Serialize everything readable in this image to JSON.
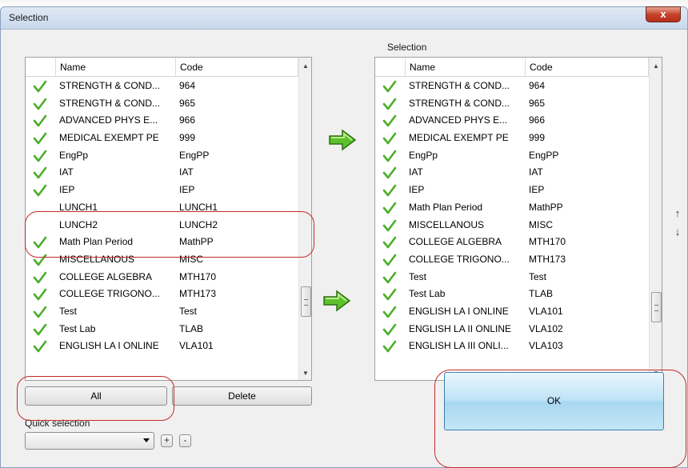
{
  "window": {
    "title": "Selection",
    "close_label": "x"
  },
  "left_list": {
    "columns": {
      "name": "Name",
      "code": "Code"
    },
    "rows": [
      {
        "name": "STRENGTH & COND...",
        "code": "964",
        "checked": true
      },
      {
        "name": "STRENGTH & COND...",
        "code": "965",
        "checked": true
      },
      {
        "name": "ADVANCED PHYS E...",
        "code": "966",
        "checked": true
      },
      {
        "name": "MEDICAL EXEMPT PE",
        "code": "999",
        "checked": true
      },
      {
        "name": "EngPp",
        "code": "EngPP",
        "checked": true
      },
      {
        "name": "IAT",
        "code": "IAT",
        "checked": true
      },
      {
        "name": "IEP",
        "code": "IEP",
        "checked": true
      },
      {
        "name": "LUNCH1",
        "code": "LUNCH1",
        "checked": false
      },
      {
        "name": "LUNCH2",
        "code": "LUNCH2",
        "checked": false
      },
      {
        "name": "Math Plan Period",
        "code": "MathPP",
        "checked": true
      },
      {
        "name": "MISCELLANOUS",
        "code": "MISC",
        "checked": true
      },
      {
        "name": "COLLEGE ALGEBRA",
        "code": "MTH170",
        "checked": true
      },
      {
        "name": "COLLEGE TRIGONO...",
        "code": "MTH173",
        "checked": true
      },
      {
        "name": "Test",
        "code": "Test",
        "checked": true
      },
      {
        "name": "Test Lab",
        "code": "TLAB",
        "checked": true
      },
      {
        "name": "ENGLISH LA I ONLINE",
        "code": "VLA101",
        "checked": true
      }
    ]
  },
  "right_list": {
    "label": "Selection",
    "columns": {
      "name": "Name",
      "code": "Code"
    },
    "rows": [
      {
        "name": "STRENGTH & COND...",
        "code": "964"
      },
      {
        "name": "STRENGTH & COND...",
        "code": "965"
      },
      {
        "name": "ADVANCED PHYS E...",
        "code": "966"
      },
      {
        "name": "MEDICAL EXEMPT PE",
        "code": "999"
      },
      {
        "name": "EngPp",
        "code": "EngPP"
      },
      {
        "name": "IAT",
        "code": "IAT"
      },
      {
        "name": "IEP",
        "code": "IEP"
      },
      {
        "name": "Math Plan Period",
        "code": "MathPP"
      },
      {
        "name": "MISCELLANOUS",
        "code": "MISC"
      },
      {
        "name": "COLLEGE ALGEBRA",
        "code": "MTH170"
      },
      {
        "name": "COLLEGE TRIGONO...",
        "code": "MTH173"
      },
      {
        "name": "Test",
        "code": "Test"
      },
      {
        "name": "Test Lab",
        "code": "TLAB"
      },
      {
        "name": "ENGLISH LA I ONLINE",
        "code": "VLA101"
      },
      {
        "name": "ENGLISH LA II ONLINE",
        "code": "VLA102"
      },
      {
        "name": "ENGLISH LA III ONLI...",
        "code": "VLA103"
      }
    ]
  },
  "buttons": {
    "all": "All",
    "delete": "Delete",
    "ok": "OK",
    "add": "+",
    "remove": "-"
  },
  "quick_selection": {
    "label": "Quick selection",
    "value": ""
  },
  "move_arrows": {
    "up": "↑",
    "down": "↓"
  },
  "colors": {
    "check": "#4caf2a",
    "arrow": "#5cc12a",
    "highlight": "#c42a2a",
    "ok_border": "#3c7fb1"
  }
}
